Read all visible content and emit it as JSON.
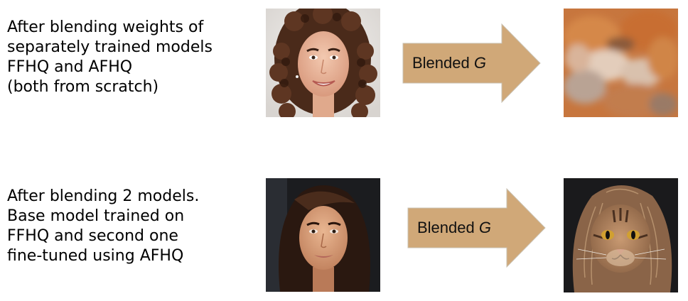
{
  "rows": [
    {
      "caption": [
        "After blending weights of",
        "separately trained models",
        "FFHQ and AFHQ",
        "(both from scratch)"
      ],
      "arrow": {
        "label": "Blended",
        "symbol": "G"
      },
      "input_image": "face-curly-hair-photo",
      "output_image": "blurry-orange-fur-texture"
    },
    {
      "caption": [
        "After blending 2 models.",
        "Base model trained on",
        "FFHQ and second one",
        "fine-tuned using AFHQ"
      ],
      "arrow": {
        "label": "Blended",
        "symbol": "G"
      },
      "input_image": "face-long-dark-hair-photo",
      "output_image": "cat-with-human-hair-photo"
    }
  ],
  "colors": {
    "arrow_fill": "#d0a878",
    "arrow_stroke": "#c9c0b0"
  }
}
